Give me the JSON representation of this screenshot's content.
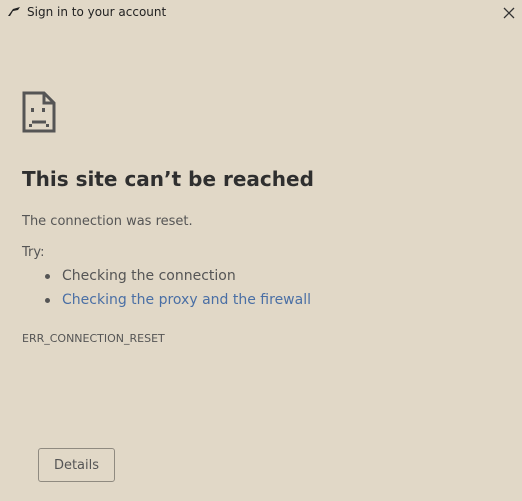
{
  "window": {
    "title": "Sign in to your account",
    "app_icon": "arrow-logo-icon",
    "close_icon": "close-icon"
  },
  "error": {
    "icon": "sad-page-icon",
    "heading": "This site can’t be reached",
    "message": "The connection was reset.",
    "try_label": "Try:",
    "suggestions": [
      {
        "text": "Checking the connection",
        "is_link": false
      },
      {
        "text": "Checking the proxy and the firewall",
        "is_link": true
      }
    ],
    "code": "ERR_CONNECTION_RESET",
    "details_button": "Details"
  },
  "colors": {
    "background": "#e1d8c7",
    "text": "#555555",
    "heading": "#2f2f2f",
    "link": "#4a6fa5"
  }
}
